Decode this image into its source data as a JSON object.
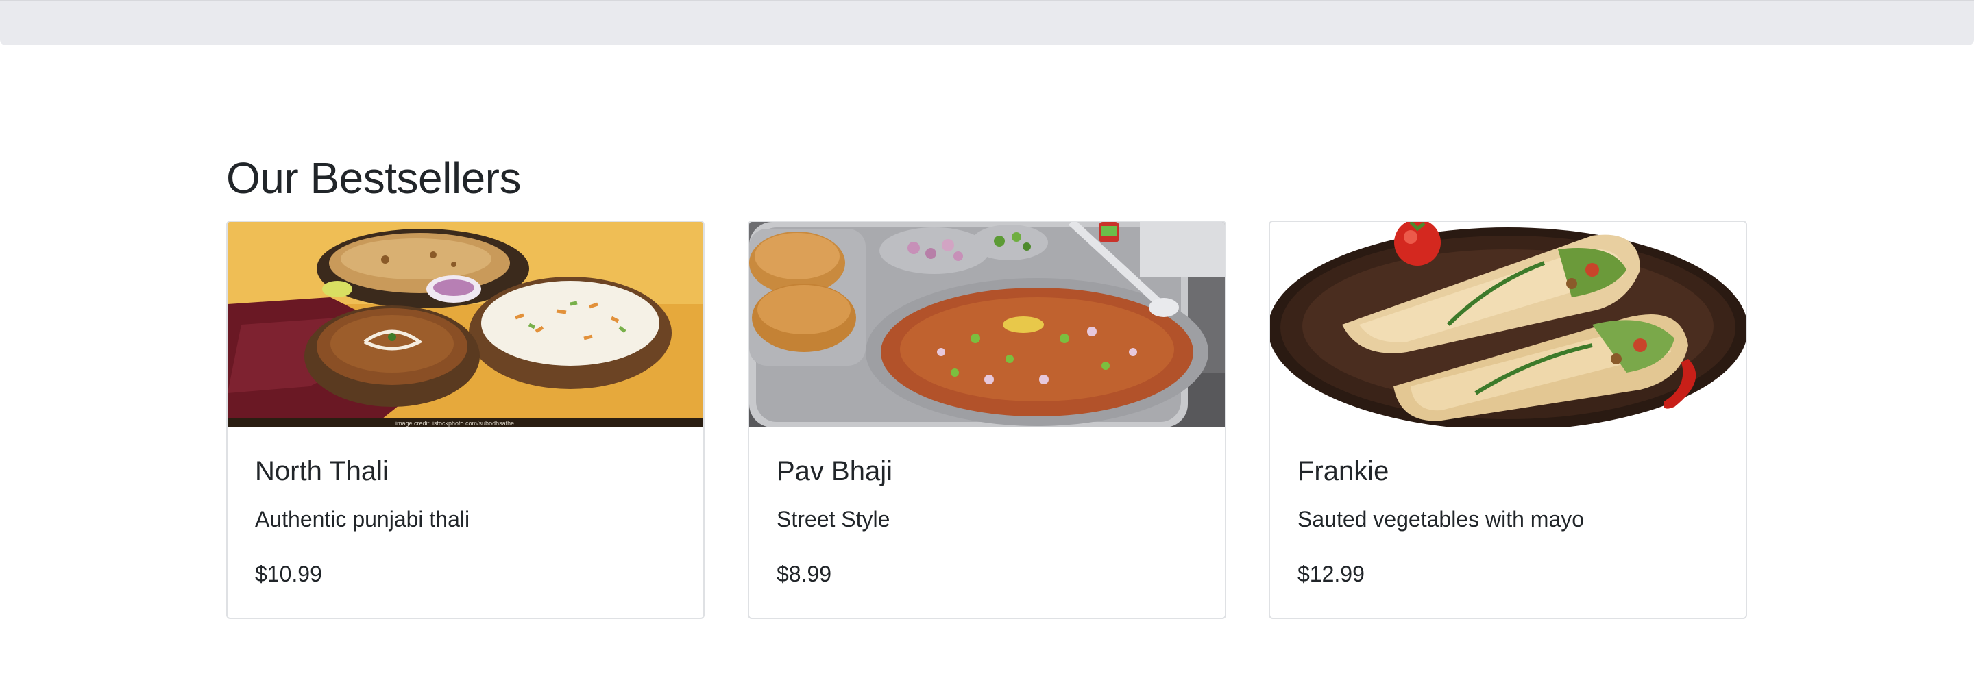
{
  "section": {
    "title": "Our Bestsellers"
  },
  "cards": [
    {
      "title": "North Thali",
      "description": "Authentic punjabi thali",
      "price": "$10.99",
      "image_icon": "north-thali-image",
      "image_caption": "image credit: istockphoto.com/subodhsathe"
    },
    {
      "title": "Pav Bhaji",
      "description": "Street Style",
      "price": "$8.99",
      "image_icon": "pav-bhaji-image"
    },
    {
      "title": "Frankie",
      "description": "Sauted vegetables with mayo",
      "price": "$12.99",
      "image_icon": "frankie-image"
    }
  ],
  "colors": {
    "topbar": "#e9eaee",
    "card_border": "#dfe1e4",
    "text": "#212529"
  }
}
